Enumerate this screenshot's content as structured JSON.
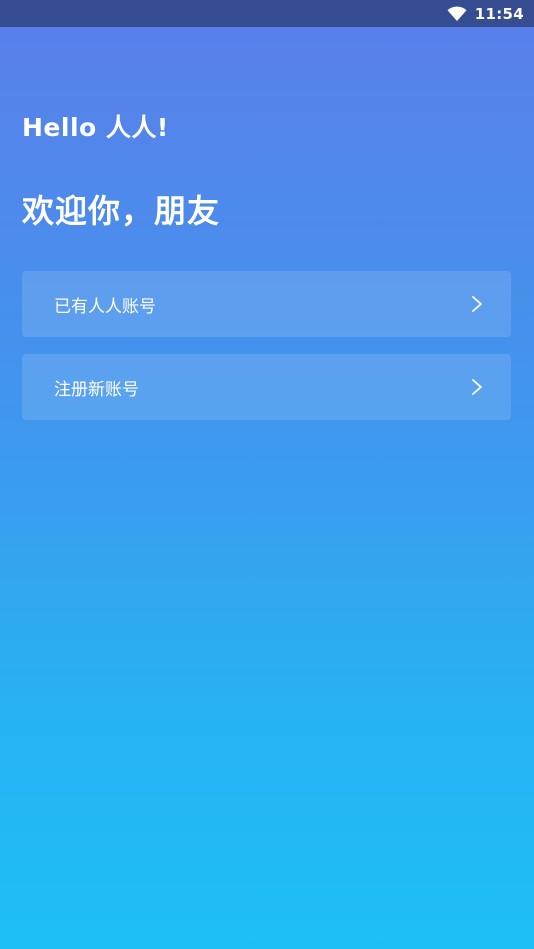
{
  "status_bar": {
    "time": "11:54",
    "wifi_icon": "wifi-icon"
  },
  "header": {
    "logo_text": "Hello 人人!",
    "welcome_text": "欢迎你，朋友"
  },
  "menu": {
    "items": [
      {
        "label": "已有人人账号",
        "icon": "chevron-right-icon"
      },
      {
        "label": "注册新账号",
        "icon": "chevron-right-icon"
      }
    ]
  },
  "colors": {
    "status_bar": "#374d91",
    "gradient_top": "#5b7ee9",
    "gradient_bottom": "#1dbff6",
    "text": "#ffffff"
  }
}
